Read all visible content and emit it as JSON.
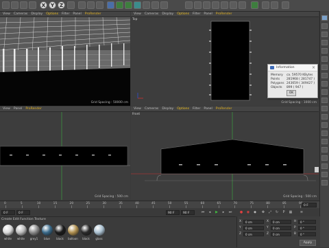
{
  "toolbar": {
    "axis_x": "X",
    "axis_y": "Y",
    "axis_z": "Z"
  },
  "viewports": {
    "perspective": {
      "menu": [
        "View",
        "Cameras",
        "Display",
        "Options",
        "Filter",
        "Panel",
        "ProRender"
      ],
      "label": "",
      "grid_spacing": "Grid Spacing : 50000 cm"
    },
    "top": {
      "menu": [
        "View",
        "Cameras",
        "Display",
        "Options",
        "Filter",
        "Panel",
        "ProRender"
      ],
      "label": "Top",
      "grid_spacing": "Grid Spacing : 1000 cm"
    },
    "right": {
      "menu": [
        "View",
        "Panel",
        "ProRender"
      ],
      "label": "",
      "grid_spacing": "Grid Spacing : 500 cm"
    },
    "front": {
      "menu": [
        "View",
        "Cameras",
        "Display",
        "Options",
        "Filter",
        "Panel",
        "ProRender"
      ],
      "label": "Front",
      "grid_spacing": "Grid Spacing : 500 cm"
    }
  },
  "info_dialog": {
    "title": "Information",
    "rows": [
      {
        "label": "Memory",
        "value": "ca. 59570 KBytes"
      },
      {
        "label": "Points",
        "value": "281968 ( 281747 )"
      },
      {
        "label": "Polygons",
        "value": "243659 ( 349427 )"
      },
      {
        "label": "Objects",
        "value": "899 ( 947 )"
      }
    ],
    "ok_label": "OK"
  },
  "timeline": {
    "ticks": [
      "0",
      "5",
      "10",
      "15",
      "20",
      "25",
      "30",
      "35",
      "40",
      "45",
      "50",
      "55",
      "60",
      "65",
      "70",
      "75",
      "80",
      "85",
      "90"
    ],
    "current_frame": "0 F",
    "start_frame": "0 F",
    "end_frame": "90 F",
    "max_frame": "90 F",
    "frame_readout": "0 F"
  },
  "materials": {
    "menu": "Create  Edit  Function  Texture",
    "items": [
      {
        "name": "white",
        "color": "#d9d9d9"
      },
      {
        "name": "white",
        "color": "#bdbdbd"
      },
      {
        "name": "grey1",
        "color": "#8a8a8a"
      },
      {
        "name": "blue",
        "color": "#3a6a8a"
      },
      {
        "name": "black",
        "color": "#1b1b1b"
      },
      {
        "name": "balloon",
        "color": "#b09050"
      },
      {
        "name": "black",
        "color": "#2a2a2a"
      },
      {
        "name": "glass",
        "color": "#aac0d0"
      }
    ]
  },
  "coordinates": {
    "rows": [
      {
        "a": "X",
        "va": "0 cm",
        "b": "X",
        "vb": "0 cm",
        "c": "H",
        "vc": "0 °"
      },
      {
        "a": "Y",
        "va": "0 cm",
        "b": "Y",
        "vb": "0 cm",
        "c": "P",
        "vc": "0 °"
      },
      {
        "a": "Z",
        "va": "0 cm",
        "b": "Z",
        "vb": "0 cm",
        "c": "B",
        "vc": "0 °"
      }
    ],
    "apply_label": "Apply"
  },
  "colors": {
    "accent": "#f0c020",
    "axis_green": "#3cb043",
    "axis_red": "#d03030"
  }
}
